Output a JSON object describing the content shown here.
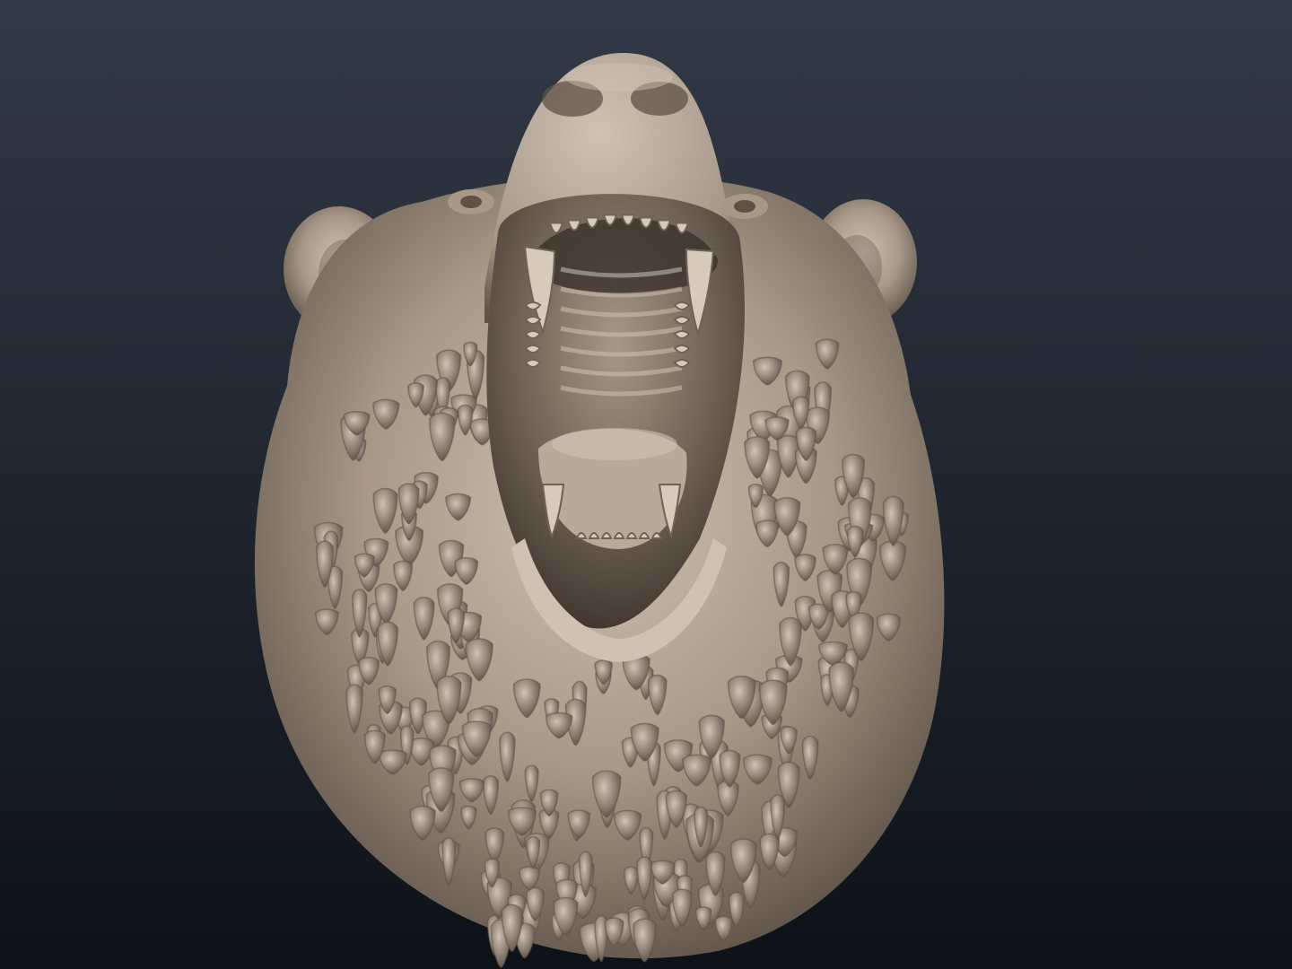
{
  "scene": {
    "subject": "bear-head-sculpt",
    "background_top": "#323a47",
    "background_bottom": "#0e1118",
    "clay_light": "#cfc2b4",
    "clay_mid": "#a79888",
    "clay_dark": "#5e5247",
    "mouth_dark": "#3a3129"
  }
}
